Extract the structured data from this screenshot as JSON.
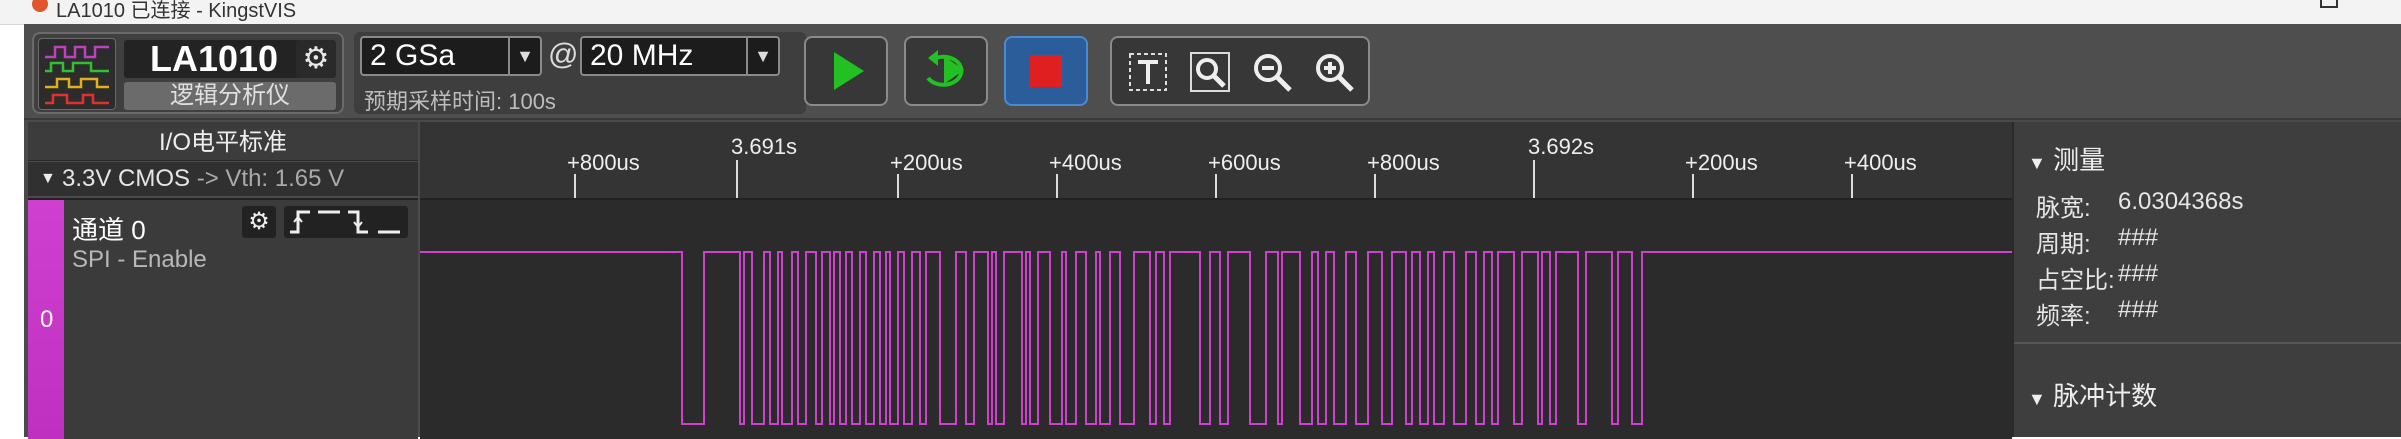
{
  "window": {
    "title": "LA1010 已连接 - KingstVIS"
  },
  "device": {
    "name": "LA1010",
    "subtitle": "逻辑分析仪"
  },
  "sampling": {
    "rate": "2 GSa",
    "at": "@",
    "frequency": "20 MHz",
    "expected_time": "预期采样时间: 100s"
  },
  "io": {
    "title": "I/O电平标准",
    "standard": "3.3V CMOS",
    "vth": "-> Vth: 1.65 V"
  },
  "channel": {
    "name": "通道 0",
    "protocol": "SPI - Enable",
    "index": "0",
    "color": "#d040d0"
  },
  "ruler": {
    "ticks": [
      "+800us",
      "3.691s",
      "+200us",
      "+400us",
      "+600us",
      "+800us",
      "3.692s",
      "+200us",
      "+400us"
    ]
  },
  "measure": {
    "title": "测量",
    "rows": [
      {
        "label": "脉宽:",
        "value": "6.0304368s"
      },
      {
        "label": "周期:",
        "value": "###"
      },
      {
        "label": "占空比:",
        "value": "###"
      },
      {
        "label": "频率:",
        "value": "###"
      }
    ]
  },
  "pulse_count": {
    "title": "脉冲计数"
  },
  "colors": {
    "accent": "#2a5d9a",
    "run_green": "#22c022",
    "stop_red": "#e02020",
    "trace": "#d040d0"
  },
  "icons": [
    "logic-analyzer-logo",
    "gear-icon",
    "play-icon",
    "loop-run-icon",
    "stop-icon",
    "text-tool-icon",
    "zoom-area-icon",
    "zoom-out-icon",
    "zoom-in-icon",
    "rising-edge-icon",
    "high-level-icon",
    "falling-edge-icon",
    "low-level-icon"
  ]
}
